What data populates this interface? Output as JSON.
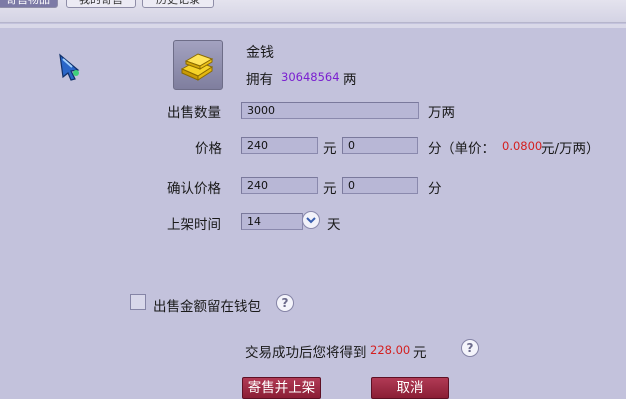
{
  "tabs": [
    "寄售物品",
    "我的寄售",
    "历史记录"
  ],
  "item": {
    "name": "金钱",
    "own_label": "拥有",
    "own_amount": "30648564",
    "own_unit": "两"
  },
  "form": {
    "quantity": {
      "label": "出售数量",
      "value": "3000",
      "unit": "万两"
    },
    "price": {
      "label": "价格",
      "yuan": "240",
      "yuan_unit": "元",
      "fen": "0",
      "fen_unit": "分",
      "unit_price_prefix": "（单价：",
      "unit_price_value": "0.0800",
      "unit_price_suffix": "元/万两）"
    },
    "confirm_price": {
      "label": "确认价格",
      "yuan": "240",
      "yuan_unit": "元",
      "fen": "0",
      "fen_unit": "分"
    },
    "listing_time": {
      "label": "上架时间",
      "value": "14",
      "unit": "天"
    }
  },
  "keep_in_wallet": {
    "label": "出售金额留在钱包",
    "checked": false
  },
  "summary": {
    "prefix": "交易成功后您将得到",
    "amount": "228.00",
    "suffix": "元"
  },
  "buttons": {
    "submit": "寄售并上架",
    "cancel": "取消"
  },
  "help_icon_text": "?",
  "icons": {
    "cursor": "pointer-cursor-icon",
    "gold": "gold-ingot-icon",
    "dropdown": "chevron-down-icon",
    "help": "help-icon"
  },
  "colors": {
    "background": "#c3c2dc",
    "accent_purple": "#7a1fd0",
    "accent_red": "#d42020",
    "button": "#9c2640"
  }
}
